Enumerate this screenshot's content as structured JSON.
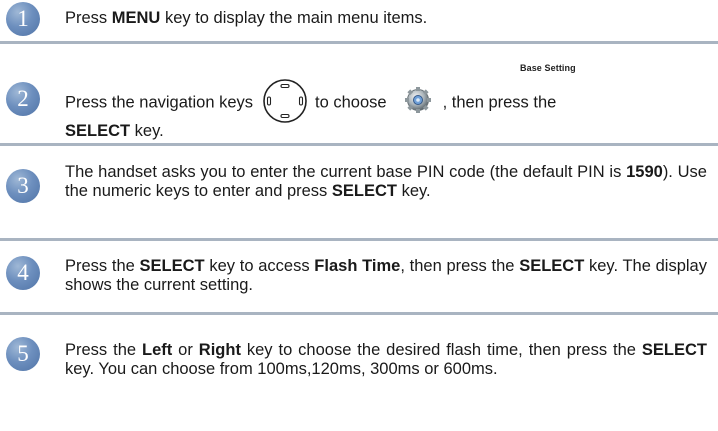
{
  "steps": [
    {
      "number": "1",
      "parts": [
        "Press ",
        "MENU",
        " key to display the main menu items."
      ]
    },
    {
      "number": "2",
      "icon_label": "Base Setting",
      "parts": [
        "Press the navigation keys",
        "to choose",
        ", then press the",
        "SELECT",
        " key."
      ],
      "icons": [
        "navigation-key-icon",
        "gear-icon"
      ]
    },
    {
      "number": "3",
      "parts": [
        "The handset asks you to enter the current base PIN code (the default PIN is ",
        "1590",
        "). Use the numeric keys to enter and press ",
        "SELECT",
        " key."
      ]
    },
    {
      "number": "4",
      "parts": [
        "Press the ",
        "SELECT",
        " key to access ",
        "Flash Time",
        ", then press the ",
        "SELECT",
        " key. The display shows the current setting."
      ]
    },
    {
      "number": "5",
      "parts": [
        "Press the ",
        "Left",
        " or ",
        "Right",
        " key to choose the desired flash time, then press the ",
        "SELECT",
        " key. You can choose from 100ms,120ms, 300ms or 600ms."
      ]
    }
  ],
  "colors": {
    "badge": "#6d8fbe",
    "divider": "#a9b4c1"
  }
}
